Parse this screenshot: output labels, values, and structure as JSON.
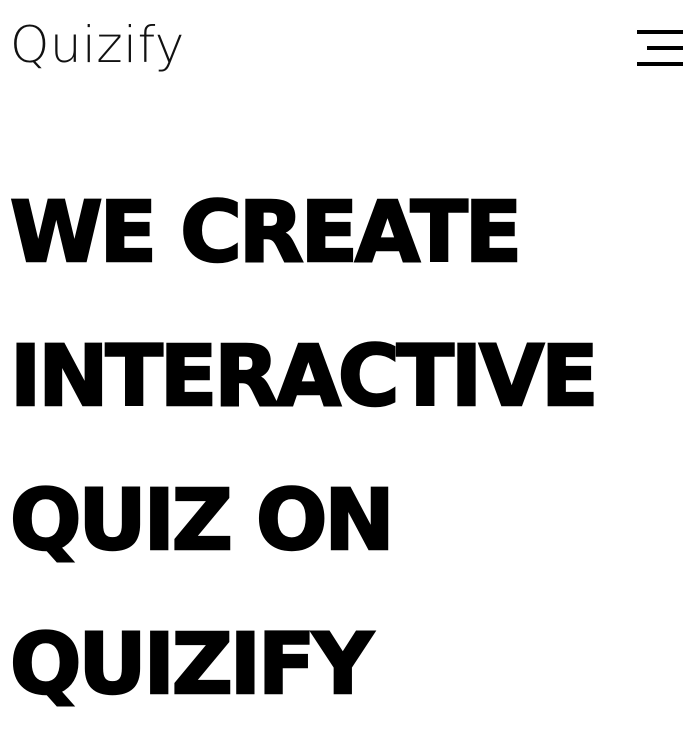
{
  "header": {
    "logo_text": "Quizify",
    "menu_icon": "hamburger-menu-icon"
  },
  "hero": {
    "lines": [
      "WE CREATE",
      "INTERACTIVE",
      "QUIZ ON",
      "QUIZIFY"
    ]
  },
  "colors": {
    "background": "#ffffff",
    "text": "#000000"
  }
}
